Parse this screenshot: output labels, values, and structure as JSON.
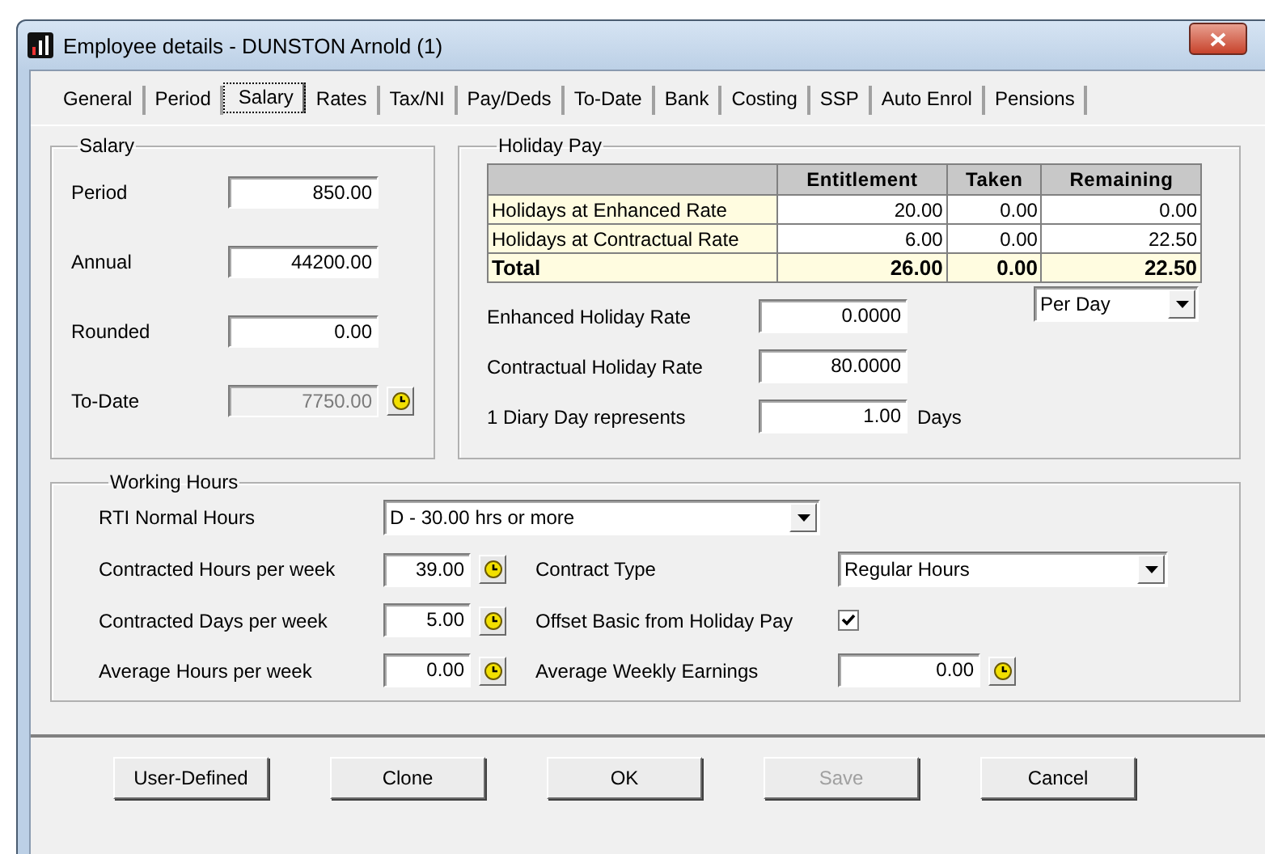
{
  "window": {
    "title": "Employee details - DUNSTON Arnold (1)"
  },
  "tabs": [
    {
      "label": "General",
      "selected": false
    },
    {
      "label": "Period",
      "selected": false
    },
    {
      "label": "Salary",
      "selected": true
    },
    {
      "label": "Rates",
      "selected": false
    },
    {
      "label": "Tax/NI",
      "selected": false
    },
    {
      "label": "Pay/Deds",
      "selected": false
    },
    {
      "label": "To-Date",
      "selected": false
    },
    {
      "label": "Bank",
      "selected": false
    },
    {
      "label": "Costing",
      "selected": false
    },
    {
      "label": "SSP",
      "selected": false
    },
    {
      "label": "Auto Enrol",
      "selected": false
    },
    {
      "label": "Pensions",
      "selected": false
    }
  ],
  "salary": {
    "title": "Salary",
    "fields": [
      {
        "label": "Period",
        "value": "850.00",
        "kind": "text",
        "disabled": false
      },
      {
        "label": "Annual",
        "value": "44200.00",
        "kind": "text",
        "disabled": false
      },
      {
        "label": "Rounded",
        "value": "0.00",
        "kind": "text",
        "disabled": false
      },
      {
        "label": "To-Date",
        "value": "7750.00",
        "kind": "text_button",
        "disabled": true
      }
    ]
  },
  "holiday_pay": {
    "title": "Holiday Pay",
    "table": {
      "columns": [
        "Entitlement",
        "Taken",
        "Remaining"
      ],
      "rows": [
        {
          "label": "Holidays at Enhanced Rate",
          "cells": [
            "20.00",
            "0.00",
            "0.00"
          ],
          "kind": "normal"
        },
        {
          "label": "Holidays at Contractual Rate",
          "cells": [
            "6.00",
            "0.00",
            "22.50"
          ],
          "kind": "normal"
        },
        {
          "label": "Total",
          "cells": [
            "26.00",
            "0.00",
            "22.50"
          ],
          "kind": "total"
        }
      ]
    },
    "fields": [
      {
        "label": "Enhanced Holiday Rate",
        "value": "0.0000"
      },
      {
        "label": "Contractual Holiday Rate",
        "value": "80.0000"
      },
      {
        "label": "1 Diary Day represents",
        "value": "1.00",
        "suffix": "Days"
      }
    ],
    "rate_basis": {
      "value": "Per Day"
    }
  },
  "working_hours": {
    "title": "Working Hours",
    "rti": {
      "label": "RTI Normal Hours",
      "value": "D - 30.00 hrs or more"
    },
    "rows": [
      {
        "left": {
          "label": "Contracted Hours per week",
          "value": "39.00"
        },
        "right": {
          "kind": "dropdown",
          "label": "Contract Type",
          "value": "Regular Hours"
        }
      },
      {
        "left": {
          "label": "Contracted Days per week",
          "value": "5.00"
        },
        "right": {
          "kind": "checkbox",
          "label": "Offset Basic from Holiday Pay",
          "checked": true
        }
      },
      {
        "left": {
          "label": "Average Hours per week",
          "value": "0.00"
        },
        "right": {
          "kind": "number",
          "label": "Average Weekly Earnings",
          "value": "0.00"
        }
      }
    ]
  },
  "buttons": [
    {
      "label": "User-Defined",
      "disabled": false
    },
    {
      "label": "Clone",
      "disabled": false
    },
    {
      "label": "OK",
      "disabled": false
    },
    {
      "label": "Save",
      "disabled": true
    },
    {
      "label": "Cancel",
      "disabled": false
    }
  ]
}
